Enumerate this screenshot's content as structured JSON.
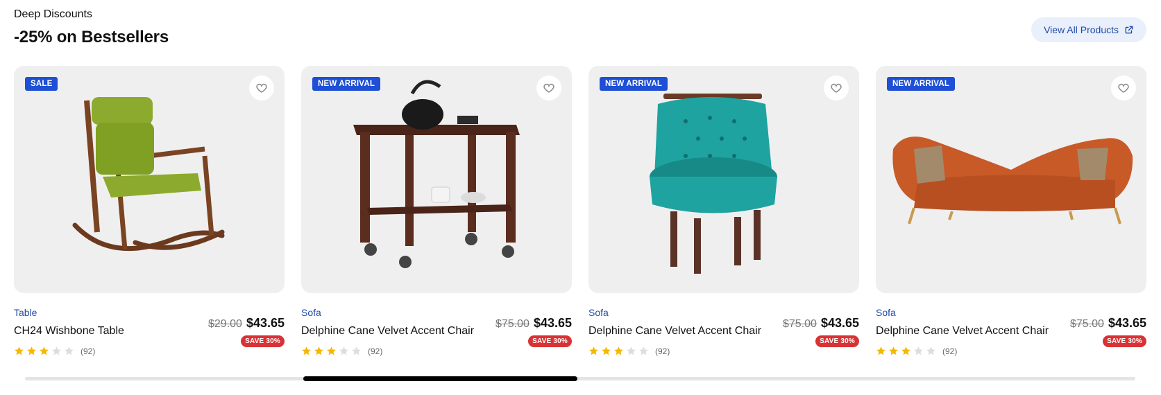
{
  "section": {
    "eyebrow": "Deep Discounts",
    "title": "-25% on Bestsellers",
    "view_all_label": "View All Products"
  },
  "colors": {
    "accent": "#1f49a8",
    "badge_bg": "#1e4fd4",
    "save_bg": "#d93235",
    "star_filled": "#f5b700",
    "star_empty": "#dddddd",
    "card_bg": "#efefef"
  },
  "products": [
    {
      "badge": "SALE",
      "category": "Table",
      "name": "CH24 Wishbone Table",
      "old_price": "$29.00",
      "price": "$43.65",
      "save": "SAVE 30%",
      "rating": 3,
      "rating_max": 5,
      "reviews": "(92)",
      "image": "rocking-chair"
    },
    {
      "badge": "NEW ARRIVAL",
      "category": "Sofa",
      "name": "Delphine Cane Velvet Accent Chair",
      "old_price": "$75.00",
      "price": "$43.65",
      "save": "SAVE 30%",
      "rating": 3,
      "rating_max": 5,
      "reviews": "(92)",
      "image": "tea-cart"
    },
    {
      "badge": "NEW ARRIVAL",
      "category": "Sofa",
      "name": "Delphine Cane Velvet Accent Chair",
      "old_price": "$75.00",
      "price": "$43.65",
      "save": "SAVE 30%",
      "rating": 3,
      "rating_max": 5,
      "reviews": "(92)",
      "image": "teal-accent-chair"
    },
    {
      "badge": "NEW ARRIVAL",
      "category": "Sofa",
      "name": "Delphine Cane Velvet Accent Chair",
      "old_price": "$75.00",
      "price": "$43.65",
      "save": "SAVE 30%",
      "rating": 3,
      "rating_max": 5,
      "reviews": "(92)",
      "image": "orange-sofa"
    }
  ],
  "icons": {
    "wishlist": "heart-icon",
    "external": "external-link-icon",
    "star": "star-icon"
  }
}
